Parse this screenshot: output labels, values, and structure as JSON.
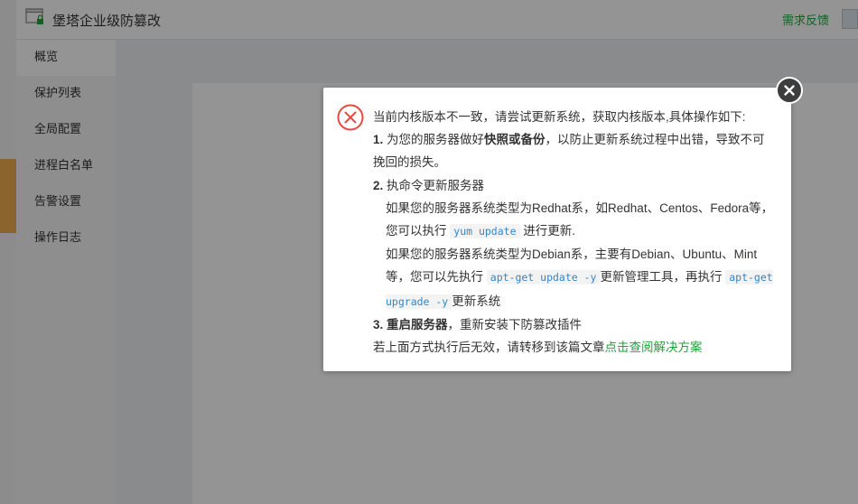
{
  "app": {
    "title": "堡塔企业级防篡改",
    "feedback": "需求反馈"
  },
  "sidebar": {
    "items": [
      {
        "label": "概览"
      },
      {
        "label": "保护列表"
      },
      {
        "label": "全局配置"
      },
      {
        "label": "进程白名单"
      },
      {
        "label": "告警设置"
      },
      {
        "label": "操作日志"
      }
    ]
  },
  "dialog": {
    "intro": "当前内核版本不一致，请尝试更新系统，获取内核版本,具体操作如下:",
    "step1_num": "1.",
    "step1_pre": "为您的服务器做好",
    "step1_bold": "快照或备份",
    "step1_post": "，以防止更新系统过程中出错，导致不可挽回的损失。",
    "step2_num": "2.",
    "step2_title": "执命令更新服务器",
    "redhat_pre": "如果您的服务器系统类型为Redhat系，如Redhat、Centos、Fedora等，您可以执行",
    "redhat_cmd": "yum update",
    "redhat_post": "进行更新.",
    "debian_pre": "如果您的服务器系统类型为Debian系，主要有Debian、Ubuntu、Mint等，您可以先执行",
    "debian_cmd1": "apt-get update -y",
    "debian_mid": "更新管理工具，再执行",
    "debian_cmd2": "apt-get upgrade -y",
    "debian_post": "更新系统",
    "step3_num": "3.",
    "step3_bold": "重启服务器",
    "step3_post": "，重新安装下防篡改插件",
    "fallback_pre": "若上面方式执行后无效，请转移到该篇文章",
    "fallback_link": "点击查阅解决方案"
  },
  "colors": {
    "accent_green": "#20a53a",
    "error_red": "#e8483d",
    "code_blue": "#3287c8"
  }
}
